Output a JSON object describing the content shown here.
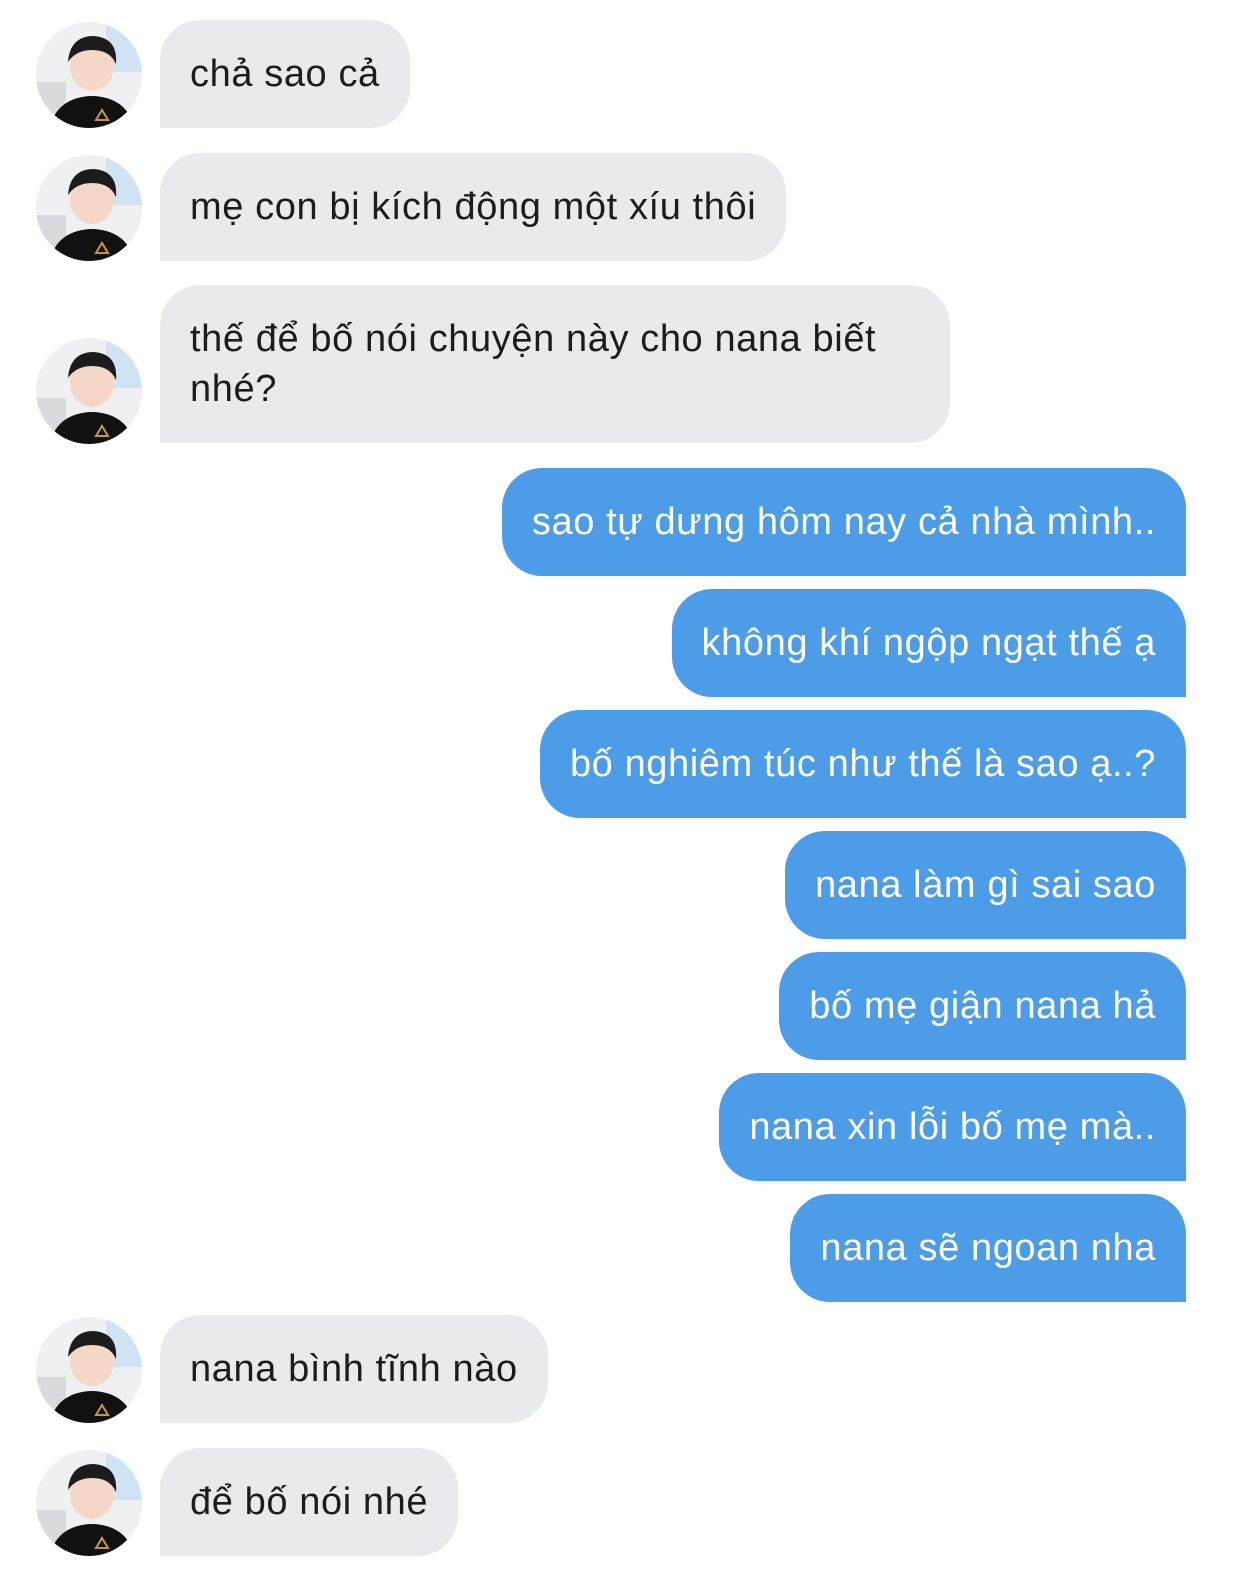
{
  "conversation": {
    "messages": [
      {
        "sender": "contact",
        "text": "chả sao cả"
      },
      {
        "sender": "contact",
        "text": "mẹ con bị kích động một xíu thôi"
      },
      {
        "sender": "contact",
        "text": "thế để bố nói chuyện này cho nana biết nhé?"
      },
      {
        "sender": "me",
        "text": "sao tự dưng hôm nay cả nhà mình.."
      },
      {
        "sender": "me",
        "text": "không khí ngộp ngạt thế ạ"
      },
      {
        "sender": "me",
        "text": "bố nghiêm túc như thế là sao ạ..?"
      },
      {
        "sender": "me",
        "text": "nana làm gì sai sao"
      },
      {
        "sender": "me",
        "text": "bố mẹ giận nana hả"
      },
      {
        "sender": "me",
        "text": "nana xin lỗi bố mẹ mà.."
      },
      {
        "sender": "me",
        "text": "nana sẽ ngoan nha"
      },
      {
        "sender": "contact",
        "text": "nana bình tĩnh nào"
      },
      {
        "sender": "contact",
        "text": "để bố nói nhé"
      }
    ]
  },
  "colors": {
    "incoming_bubble": "#e9eaee",
    "outgoing_bubble": "#4d9ce8",
    "incoming_text": "#1c1c1e",
    "outgoing_text": "#ffffff",
    "background": "#ffffff"
  },
  "icons": {
    "contact_avatar": "avatar-photo-icon"
  }
}
